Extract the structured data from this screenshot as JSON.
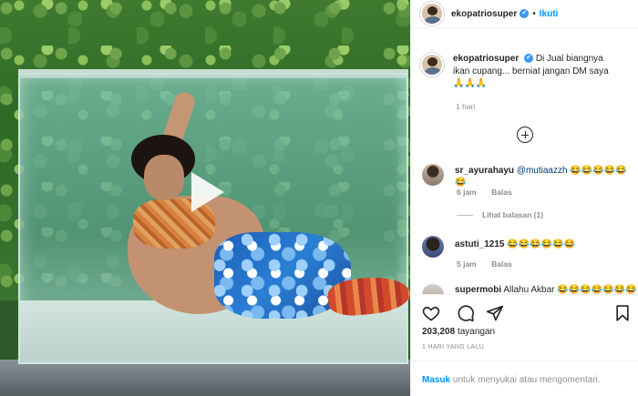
{
  "post": {
    "username": "ekopatriosuper",
    "separator": "•",
    "follow_label": "Ikuti",
    "verified_glyph": "✔",
    "caption": "Di Jual biangnya ikan cupang... berniat jangan DM saya",
    "caption_emoji": "🙏🙏🙏",
    "caption_time": "1 hari"
  },
  "comments": [
    {
      "username": "sr_ayurahayu",
      "mention": "@mutiaazzh",
      "text": "😂😂😂😂😂😂",
      "time": "6 jam",
      "reply_label": "Balas",
      "view_replies": "Lihat balasan (1)"
    },
    {
      "username": "astuti_1215",
      "text": "😂😂😂😂😂😂",
      "time": "5 jam",
      "reply_label": "Balas"
    },
    {
      "username": "supermobi",
      "text": "Allahu Akbar 😂😂😂😂😂😂😂"
    }
  ],
  "stats": {
    "views": "203,208",
    "views_label": "tayangan",
    "date": "1 HARI YANG LALU"
  },
  "login_prompt": {
    "link": "Masuk",
    "text": "untuk menyukai atau mengomentari."
  },
  "icons": {
    "play": "play-icon",
    "add": "add-comment-icon",
    "like": "heart-icon",
    "comment": "comment-icon",
    "share": "share-icon",
    "save": "bookmark-icon"
  },
  "colors": {
    "link_blue": "#0095f6",
    "verified_blue": "#3897f0",
    "text": "#262626",
    "muted": "#8e8e8e"
  }
}
